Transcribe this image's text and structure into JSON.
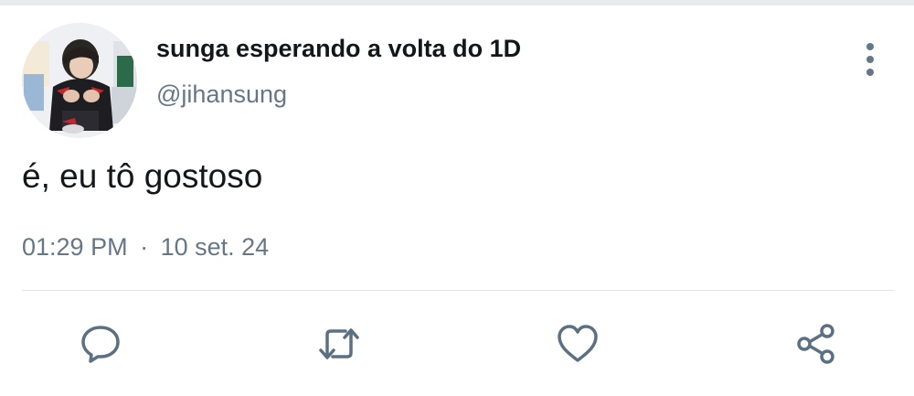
{
  "tweet": {
    "display_name": "sunga esperando a volta do 1D",
    "handle": "@jihansung",
    "text": "é, eu tô gostoso",
    "time": "01:29 PM",
    "separator": "·",
    "date": "10 set. 24"
  },
  "icons": {
    "avatar": "profile-photo",
    "more": "vertical-ellipsis-icon",
    "reply": "speech-bubble-icon",
    "retweet": "retweet-arrows-icon",
    "like": "heart-icon",
    "share": "share-nodes-icon"
  },
  "colors": {
    "text": "#14171a",
    "secondary": "#657786",
    "divider": "#e1e5e8",
    "icon": "#5b7083"
  }
}
